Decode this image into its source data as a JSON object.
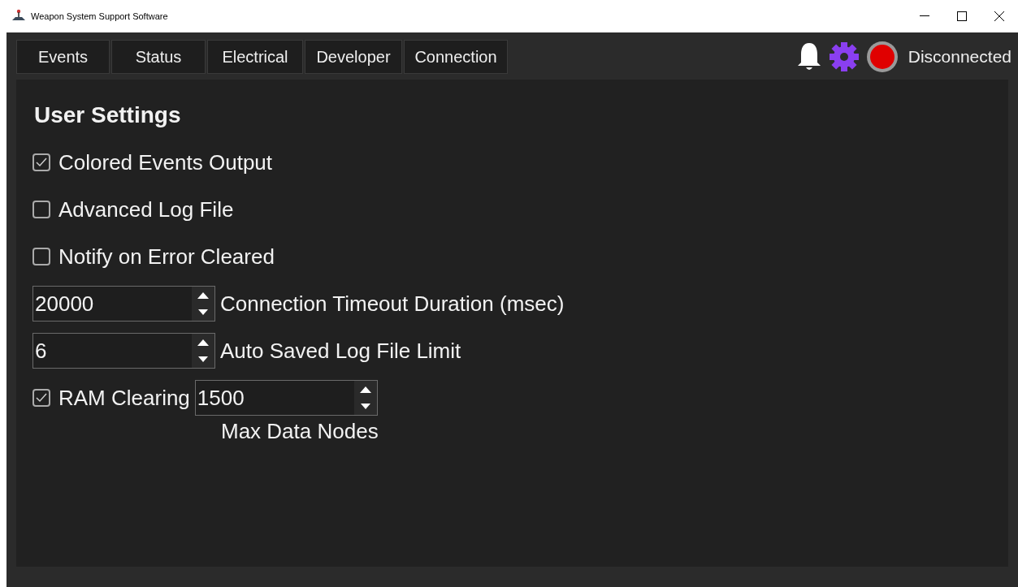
{
  "window": {
    "title": "Weapon System Support Software"
  },
  "tabs": [
    {
      "label": "Events"
    },
    {
      "label": "Status"
    },
    {
      "label": "Electrical"
    },
    {
      "label": "Developer"
    },
    {
      "label": "Connection"
    }
  ],
  "status": {
    "label": "Disconnected",
    "connected": false
  },
  "heading": "User Settings",
  "settings": [
    {
      "kind": "checkbox",
      "label": "Colored Events Output",
      "checked": true
    },
    {
      "kind": "checkbox",
      "label": "Advanced Log File",
      "checked": false
    },
    {
      "kind": "checkbox",
      "label": "Notify on Error Cleared",
      "checked": false
    },
    {
      "kind": "spinbox",
      "value": "20000",
      "caption": "Connection Timeout Duration (msec)"
    },
    {
      "kind": "spinbox",
      "value": "6",
      "caption": "Auto Saved Log File Limit"
    },
    {
      "kind": "checkbox_spinbox",
      "label": "RAM Clearing",
      "checked": true,
      "value": "1500",
      "caption": "Max Data Nodes"
    }
  ]
}
